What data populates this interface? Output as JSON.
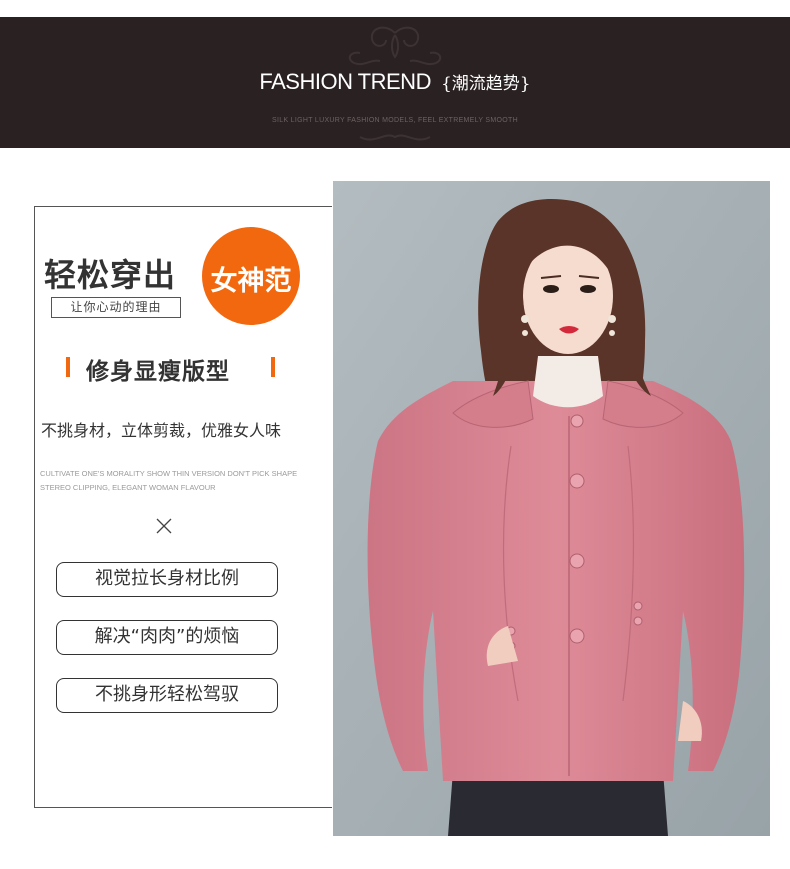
{
  "banner": {
    "title_en": "FASHION TREND",
    "title_cn": "{潮流趋势}",
    "subtitle": "SILK LIGHT LUXURY FASHION MODELS, FEEL EXTREMELY SMOOTH"
  },
  "promo": {
    "headline": "轻松穿出",
    "badge": "女神范",
    "reason": "让你心动的理由",
    "feature_title": "修身显瘦版型",
    "description": "不挑身材，立体剪裁，优雅女人味",
    "description_en_line1": "CULTIVATE ONE'S MORALITY SHOW THIN VERSION DON'T PICK SHAPE",
    "description_en_line2": "STEREO CLIPPING, ELEGANT WOMAN FLAVOUR",
    "tags": [
      "视觉拉长身材比例",
      "解决“肉肉”的烦恼",
      "不挑身形轻松驾驭"
    ]
  },
  "colors": {
    "banner_bg": "#2a2122",
    "accent_orange": "#f2680f",
    "coat_pink": "#d9818f",
    "photo_bg": "#a3adb2"
  },
  "icons": {
    "cross": "cross-icon",
    "ornament": "floral-ornament-icon"
  }
}
